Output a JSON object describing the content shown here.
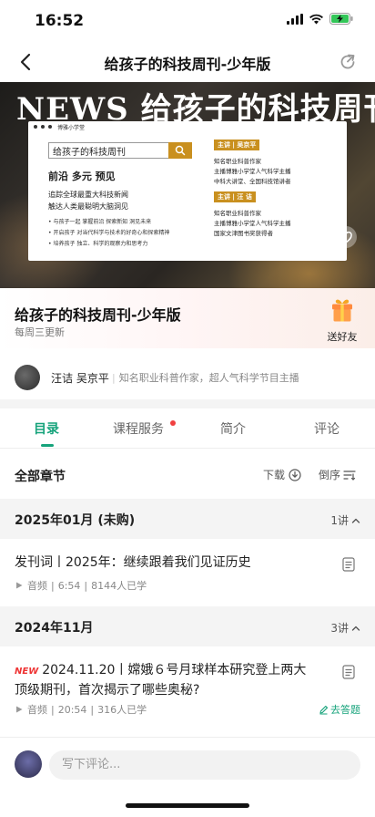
{
  "status_bar": {
    "time": "16:52"
  },
  "nav": {
    "title": "给孩子的科技周刊-少年版"
  },
  "banner": {
    "headline": "NEWS 给孩子的科技周刊",
    "card": {
      "brand": "博雅小学堂",
      "search_text": "给孩子的科技周刊",
      "subtitle": "前沿  多元  预见",
      "line1": "追踪全球最重大科技新闻",
      "line2": "触达人类最聪明大脑洞见",
      "bullet1": "• 与孩子一起 掌握前沿 探索新知 洞见未来",
      "bullet2": "• 开启孩子 对当代科学与技术的好奇心和探索精神",
      "bullet3": "• 培养孩子 独立、科学的观察力和思考力",
      "host1_tag": "主讲 | 吴京平",
      "host1_info1": "知名职业科普作家",
      "host1_info2": "主播博雅小学堂人气科学主播",
      "host1_info3": "中科大讲堂、全国科技馆讲者",
      "host2_tag": "主讲 | 汪 诘",
      "host2_info1": "知名职业科普作家",
      "host2_info2": "主播博雅小学堂人气科学主播",
      "host2_info3": "国家文津图书奖获得者"
    }
  },
  "info": {
    "title": "给孩子的科技周刊-少年版",
    "subtitle": "每周三更新",
    "gift_label": "送好友"
  },
  "author": {
    "names": "汪诘 吴京平",
    "description": "知名职业科普作家，超人气科学节目主播"
  },
  "tabs": [
    {
      "label": "目录",
      "active": true
    },
    {
      "label": "课程服务",
      "active": false
    },
    {
      "label": "简介",
      "active": false
    },
    {
      "label": "评论",
      "active": false
    }
  ],
  "chapters": {
    "title": "全部章节",
    "download_label": "下载",
    "sort_label": "倒序"
  },
  "groups": [
    {
      "title": "2025年01月 (未购)",
      "count": "1讲",
      "lessons": [
        {
          "title": "发刊词丨2025年：继续跟着我们见证历史",
          "type": "音频",
          "duration": "6:54",
          "learners": "8144人已学"
        }
      ]
    },
    {
      "title": "2024年11月",
      "count": "3讲",
      "lessons": [
        {
          "badge": "NEW",
          "title": "2024.11.20丨嫦娥６号月球样本研究登上两大顶级期刊，首次揭示了哪些奥秘?",
          "type": "音频",
          "duration": "20:54",
          "learners": "316人已学",
          "answer_label": "去答题"
        }
      ]
    }
  ],
  "comment": {
    "placeholder": "写下评论..."
  },
  "colors": {
    "accent": "#16a37b",
    "badge_red": "#e33333",
    "banner_gold": "#c9901f"
  }
}
